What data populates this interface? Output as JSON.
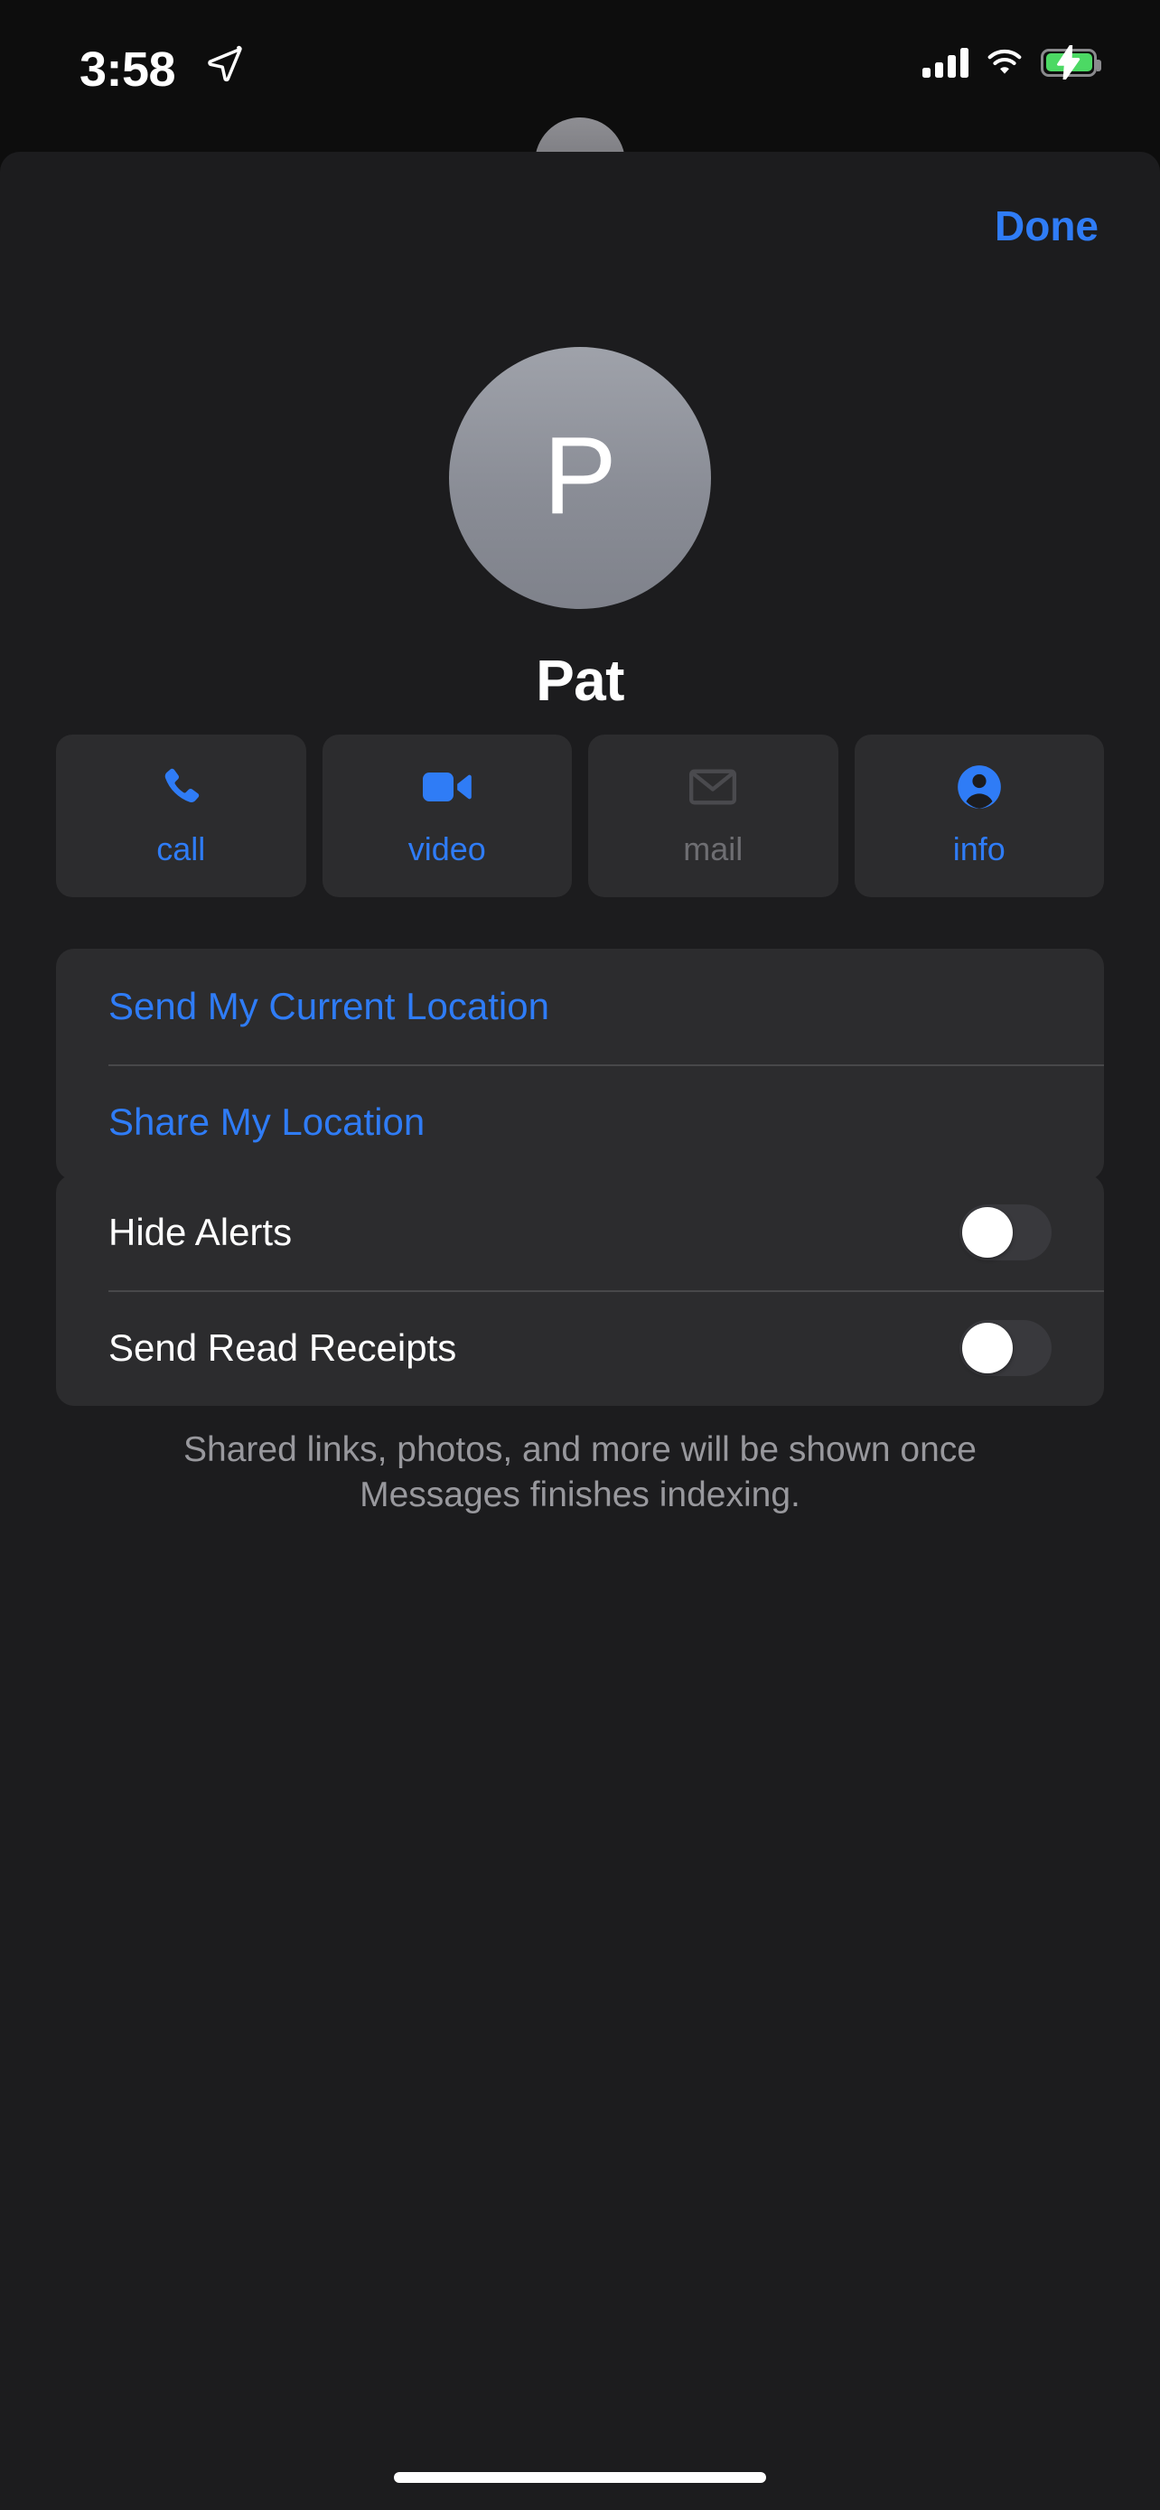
{
  "status_bar": {
    "time": "3:58",
    "location_icon": "location-arrow-icon",
    "signal_icon": "cellular-signal-icon",
    "signal_bars": 4,
    "wifi_icon": "wifi-icon",
    "battery_icon": "battery-charging-icon",
    "battery_charging": true,
    "battery_color": "#4cd964"
  },
  "sheet": {
    "done_label": "Done",
    "accent_color": "#2f7cf6",
    "background_color": "#1c1c1e",
    "card_color": "#2c2c2e"
  },
  "contact": {
    "initial": "P",
    "name": "Pat",
    "avatar_icon": "contact-avatar"
  },
  "actions": [
    {
      "label": "call",
      "icon": "phone-icon",
      "enabled": true
    },
    {
      "label": "video",
      "icon": "video-camera-icon",
      "enabled": true
    },
    {
      "label": "mail",
      "icon": "envelope-icon",
      "enabled": false
    },
    {
      "label": "info",
      "icon": "person-circle-icon",
      "enabled": true
    }
  ],
  "location_card": {
    "rows": [
      {
        "label": "Send My Current Location"
      },
      {
        "label": "Share My Location"
      }
    ]
  },
  "settings_card": {
    "rows": [
      {
        "label": "Hide Alerts",
        "toggle_on": false
      },
      {
        "label": "Send Read Receipts",
        "toggle_on": false
      }
    ]
  },
  "footer": {
    "note": "Shared links, photos, and more will be shown once Messages finishes indexing."
  },
  "home_indicator": {
    "name": "home-indicator"
  }
}
